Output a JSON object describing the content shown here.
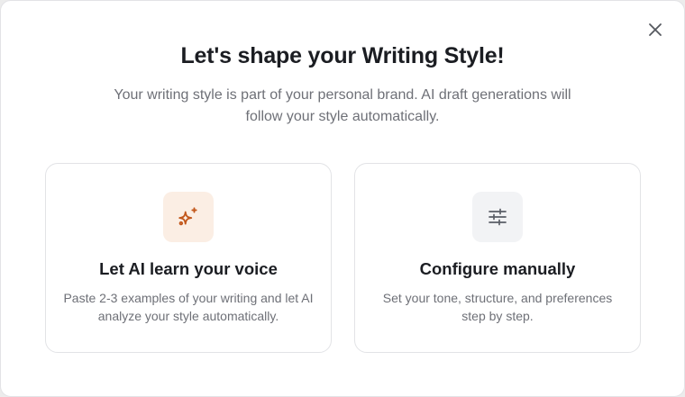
{
  "modal": {
    "title": "Let's shape your Writing Style!",
    "subtitle": "Your writing style is part of your personal brand. AI draft generations will follow your style automatically."
  },
  "options": [
    {
      "title": "Let AI learn your voice",
      "description": "Paste 2-3 examples of your writing and let AI analyze your style automatically.",
      "icon": "sparkles-icon",
      "icon_color": "#c2571b",
      "icon_bg": "#fbeee4"
    },
    {
      "title": "Configure manually",
      "description": "Set your tone, structure, and preferences step by step.",
      "icon": "sliders-icon",
      "icon_color": "#5a5d66",
      "icon_bg": "#f2f3f5"
    }
  ],
  "close_icon": "close-icon"
}
